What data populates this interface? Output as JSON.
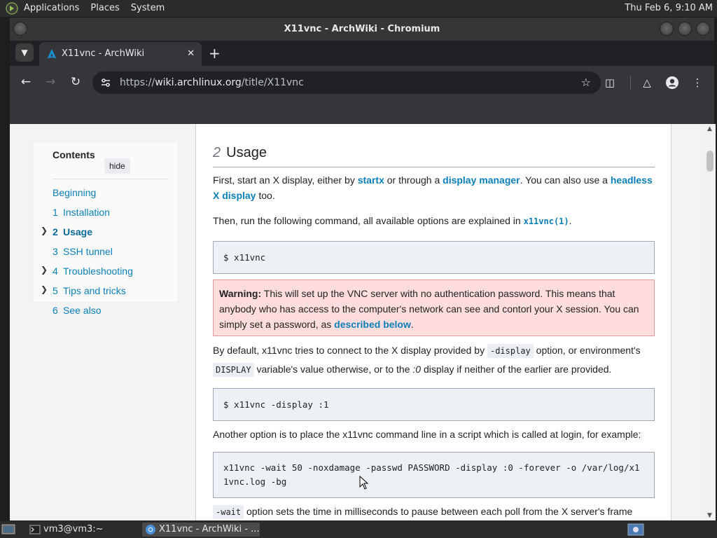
{
  "top_panel": {
    "menus": [
      "Applications",
      "Places",
      "System"
    ],
    "clock": "Thu Feb  6,  9:10 AM"
  },
  "window": {
    "title": "X11vnc - ArchWiki - Chromium"
  },
  "tab": {
    "title": "X11vnc - ArchWiki",
    "close": "✕",
    "new_tab": "+"
  },
  "omnibox": {
    "scheme": "https://",
    "host": "wiki.archlinux.org",
    "path": "/title/X11vnc"
  },
  "toc": {
    "heading": "Contents",
    "hide_label": "hide",
    "items": [
      {
        "num": "",
        "label": "Beginning",
        "expandable": false,
        "active": false
      },
      {
        "num": "1",
        "label": "Installation",
        "expandable": false,
        "active": false
      },
      {
        "num": "2",
        "label": "Usage",
        "expandable": true,
        "active": true
      },
      {
        "num": "3",
        "label": "SSH tunnel",
        "expandable": false,
        "active": false
      },
      {
        "num": "4",
        "label": "Troubleshooting",
        "expandable": true,
        "active": false
      },
      {
        "num": "5",
        "label": "Tips and tricks",
        "expandable": true,
        "active": false
      },
      {
        "num": "6",
        "label": "See also",
        "expandable": false,
        "active": false
      }
    ]
  },
  "article": {
    "section_num": "2",
    "section_title": "Usage",
    "p1": {
      "t1": "First, start an X display, either by ",
      "l1": "startx",
      "t2": " or through a ",
      "l2": "display manager",
      "t3": ". You can also use a ",
      "l3": "headless X display",
      "t4": " too."
    },
    "p2": {
      "t1": "Then, run the following command, all available options are explained in ",
      "l1": "x11vnc(1)",
      "t2": "."
    },
    "code1": "$ x11vnc",
    "warning": {
      "label": "Warning:",
      "text": " This will set up the VNC server with no authentication password. This means that anybody who has access to the computer's network can see and contorl your X session. You can simply set a password, as ",
      "link": "described below",
      "end": "."
    },
    "p3": {
      "t1": "By default, x11vnc tries to connect to the X display provided by ",
      "c1": "-display",
      "t2": " option, or environment's ",
      "c2": "DISPLAY",
      "t3": " variable's value otherwise, or to the ",
      "e1": ":0",
      "t4": " display if neither of the earlier are provided."
    },
    "code2": "$ x11vnc -display :1",
    "p4": "Another option is to place the x11vnc command line in a script which is called at login, for example:",
    "code3": "x11vnc -wait 50 -noxdamage -passwd PASSWORD -display :0 -forever -o /var/log/x11vnc.log -bg",
    "p5": {
      "c1": "-wait",
      "t1": " option sets the time in milliseconds to pause between each poll from the X server's frame"
    }
  },
  "taskbar": {
    "tasks": [
      "vm3@vm3:~",
      "X11vnc - ArchWiki - ..."
    ]
  },
  "colors": {
    "link": "#0b7fb8",
    "warning_bg": "#ffdddd",
    "code_bg": "#ebf1f5",
    "chrome_dark": "#35363a"
  }
}
